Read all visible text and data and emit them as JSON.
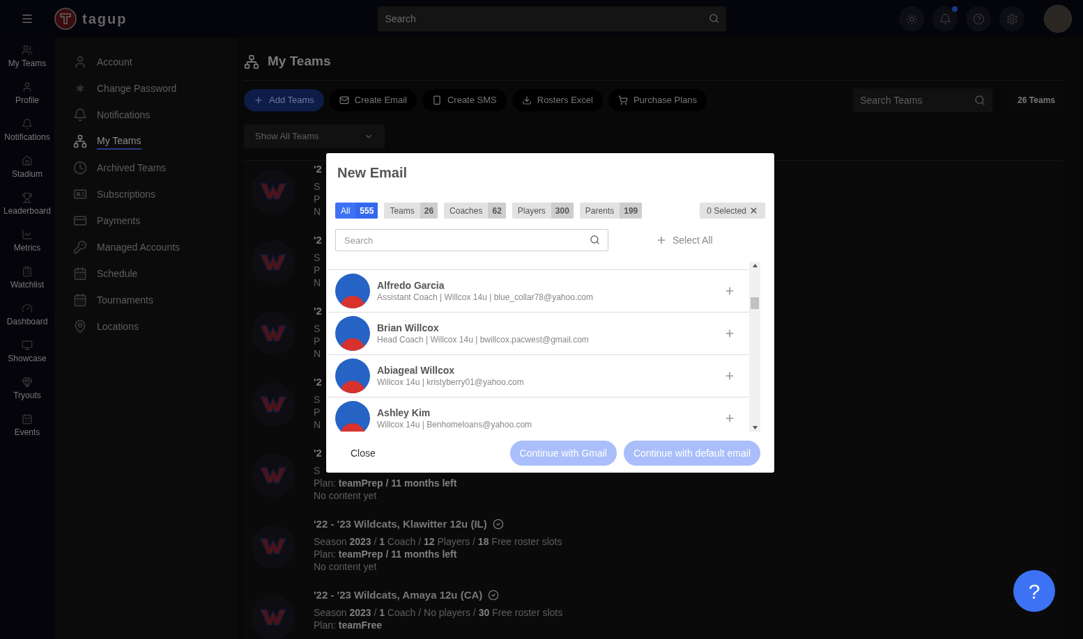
{
  "topbar": {
    "logo": "tagup",
    "search_placeholder": "Search"
  },
  "rail": [
    {
      "label": "My Teams"
    },
    {
      "label": "Profile"
    },
    {
      "label": "Notifications"
    },
    {
      "label": "Stadium"
    },
    {
      "label": "Leaderboard"
    },
    {
      "label": "Metrics"
    },
    {
      "label": "Watchlist"
    },
    {
      "label": "Dashboard"
    },
    {
      "label": "Showcase"
    },
    {
      "label": "Tryouts"
    },
    {
      "label": "Events"
    }
  ],
  "settings_nav": [
    {
      "label": "Account",
      "selected": false
    },
    {
      "label": "Change Password",
      "selected": false
    },
    {
      "label": "Notifications",
      "selected": false
    },
    {
      "label": "My Teams",
      "selected": true
    },
    {
      "label": "Archived Teams",
      "selected": false
    },
    {
      "label": "Subscriptions",
      "selected": false
    },
    {
      "label": "Payments",
      "selected": false
    },
    {
      "label": "Managed Accounts",
      "selected": false
    },
    {
      "label": "Schedule",
      "selected": false
    },
    {
      "label": "Tournaments",
      "selected": false
    },
    {
      "label": "Locations",
      "selected": false
    }
  ],
  "page_title": "My Teams",
  "toolbar": [
    {
      "label": "Add Teams",
      "kind": "primary"
    },
    {
      "label": "Create Email",
      "kind": "email"
    },
    {
      "label": "Create SMS",
      "kind": "sms"
    },
    {
      "label": "Rosters Excel",
      "kind": "download"
    },
    {
      "label": "Purchase Plans",
      "kind": "cart"
    }
  ],
  "search_teams": {
    "placeholder": "Search Teams"
  },
  "team_count": "26 Teams",
  "filter": {
    "value": "Show All Teams"
  },
  "teams": [
    {
      "title": "'2",
      "lines": [
        "S",
        "P",
        "N"
      ]
    },
    {
      "title": "'2",
      "lines": [
        "S",
        "P",
        "N"
      ]
    },
    {
      "title": "'2",
      "lines": [
        "S",
        "P",
        "N"
      ]
    },
    {
      "title": "'2",
      "lines": [
        "S",
        "P",
        "N"
      ]
    },
    {
      "title": "'2",
      "lines": [
        "S",
        "Plan: **teamPrep / 11 months left**",
        "No content yet"
      ]
    },
    {
      "title": "'22 - '23 Wildcats, Klawitter 12u (IL)",
      "verified": true,
      "lines": [
        "Season **2023** / **1** Coach / **12** Players / **18** Free roster slots",
        "Plan: **teamPrep / 11 months left**",
        "No content yet"
      ]
    },
    {
      "title": "'22 - '23 Wildcats, Amaya 12u (CA)",
      "verified": true,
      "lines": [
        "Season **2023** / **1** Coach / No players / **30** Free roster slots",
        "Plan: **teamFree**"
      ]
    }
  ],
  "modal": {
    "title": "New Email",
    "filters": [
      {
        "label": "All",
        "count": "555",
        "selected": true
      },
      {
        "label": "Teams",
        "count": "26",
        "selected": false
      },
      {
        "label": "Coaches",
        "count": "62",
        "selected": false
      },
      {
        "label": "Players",
        "count": "300",
        "selected": false
      },
      {
        "label": "Parents",
        "count": "199",
        "selected": false
      }
    ],
    "selected_count": "0 Selected",
    "search_placeholder": "Search",
    "select_all": "Select All",
    "contacts": [
      {
        "name": "Alfredo Garcia",
        "detail": "Assistant Coach | Willcox 14u | blue_collar78@yahoo.com"
      },
      {
        "name": "Brian Willcox",
        "detail": "Head Coach | Willcox 14u | bwillcox.pacwest@gmail.com"
      },
      {
        "name": "Abiageal Willcox",
        "detail": "Willcox 14u | kristyberry01@yahoo.com"
      },
      {
        "name": "Ashley Kim",
        "detail": "Willcox 14u | Benhomeloans@yahoo.com"
      }
    ],
    "close": "Close",
    "actions": [
      {
        "label": "Continue with Gmail",
        "disabled": true
      },
      {
        "label": "Continue with default email",
        "disabled": true
      }
    ]
  },
  "help": "?"
}
